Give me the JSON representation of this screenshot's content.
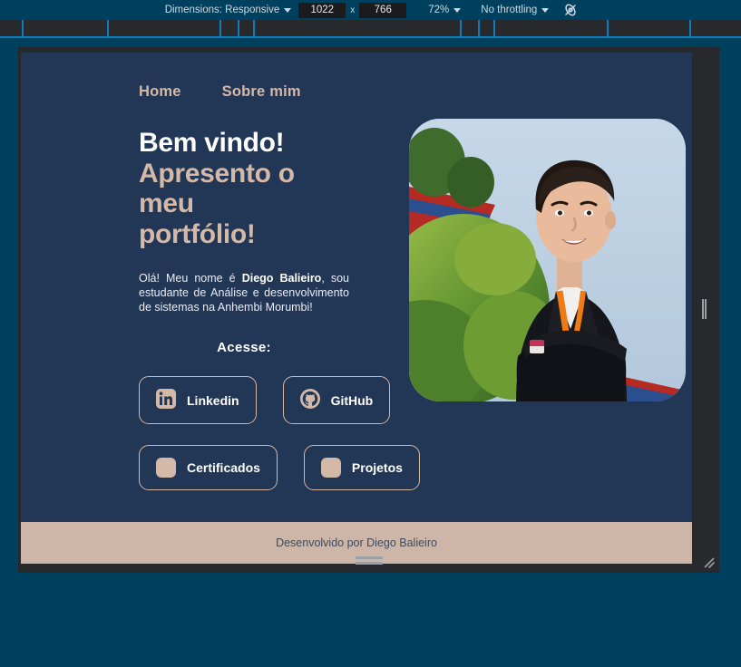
{
  "devtools": {
    "dimensions_label": "Dimensions: Responsive",
    "width_value": "1022",
    "height_value": "766",
    "times_symbol": "x",
    "zoom_label": "72%",
    "throttling_label": "No throttling",
    "throttle_icon": "network-conditions-icon",
    "ruler_ticks": [
      24,
      118,
      242,
      262,
      279,
      507,
      527,
      544,
      669,
      760
    ]
  },
  "site": {
    "nav": [
      {
        "label": "Home"
      },
      {
        "label": "Sobre mim"
      }
    ],
    "hero": {
      "title_line1": "Bem vindo!",
      "title_line2": "Apresento o",
      "title_line3": "meu",
      "title_line4": "portfólio!",
      "paragraph_pre": "Olá! Meu nome é ",
      "paragraph_bold": "Diego Balieiro",
      "paragraph_post": ", sou estudante de Análise e desenvolvimento de sistemas na Anhembi Morumbi!",
      "acesse_label": "Acesse:",
      "buttons": [
        {
          "label": "Linkedin",
          "icon": "linkedin-icon"
        },
        {
          "label": "GitHub",
          "icon": "github-icon"
        },
        {
          "label": "Certificados",
          "icon": "certificate-icon"
        },
        {
          "label": "Projetos",
          "icon": "projects-icon"
        }
      ],
      "photo_alt": "profile-photo"
    },
    "footer": {
      "text": "Desenvolvido por Diego Balieiro"
    },
    "colors": {
      "page_bg": "#223655",
      "accent_tan": "#d4b8a8",
      "footer_bg": "#cdb5a7",
      "devtools_bg": "#00405f",
      "frame_bg": "#27292d",
      "ruler_tick": "#0b7dba"
    }
  }
}
